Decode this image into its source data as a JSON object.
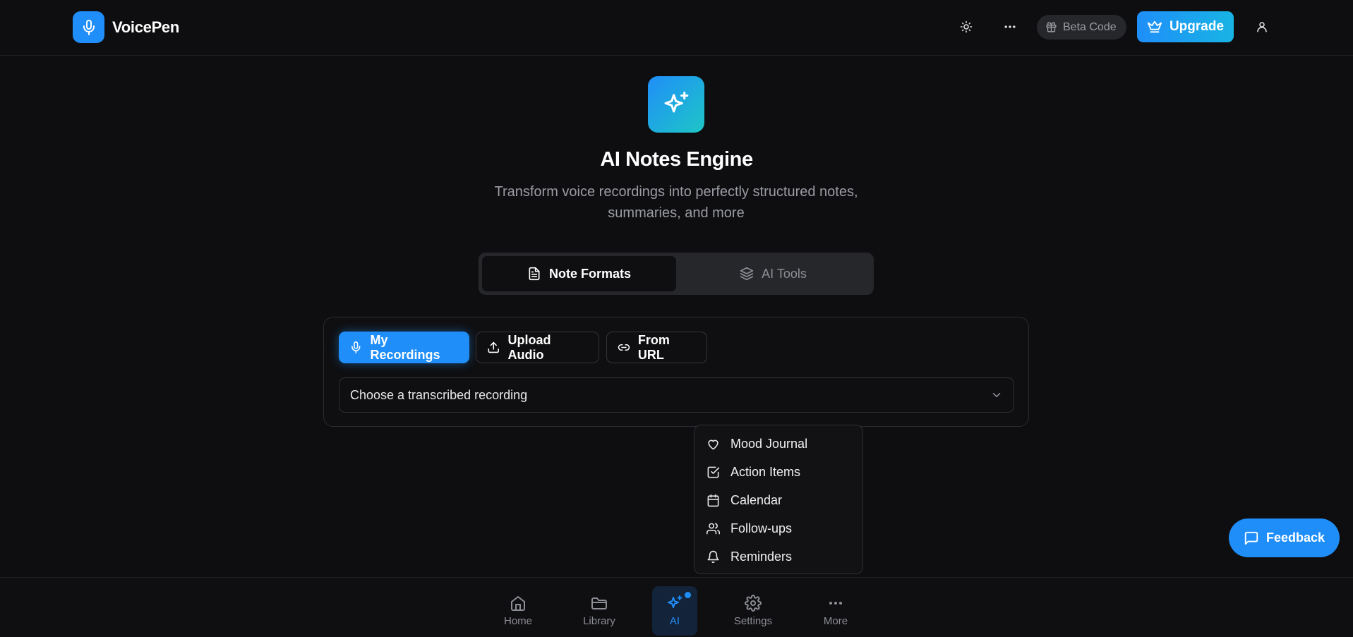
{
  "app": {
    "name": "VoicePen"
  },
  "header": {
    "beta_label": "Beta Code",
    "upgrade_label": "Upgrade"
  },
  "hero": {
    "title": "AI Notes Engine",
    "subtitle": "Transform voice recordings into perfectly structured notes, summaries, and more"
  },
  "tabs": [
    {
      "label": "Note Formats",
      "active": true
    },
    {
      "label": "AI Tools",
      "active": false
    }
  ],
  "sources": [
    {
      "label": "My Recordings",
      "active": true
    },
    {
      "label": "Upload Audio",
      "active": false
    },
    {
      "label": "From URL",
      "active": false
    }
  ],
  "recording_select": {
    "placeholder": "Choose a transcribed recording"
  },
  "menu": {
    "items": [
      {
        "label": "Mood Journal",
        "icon": "heart-icon"
      },
      {
        "label": "Action Items",
        "icon": "checkbox-icon"
      },
      {
        "label": "Calendar",
        "icon": "calendar-icon"
      },
      {
        "label": "Follow-ups",
        "icon": "users-icon"
      },
      {
        "label": "Reminders",
        "icon": "bell-icon"
      }
    ]
  },
  "feedback": {
    "label": "Feedback"
  },
  "bottom_nav": {
    "items": [
      {
        "label": "Home",
        "icon": "home-icon"
      },
      {
        "label": "Library",
        "icon": "folder-icon"
      },
      {
        "label": "AI",
        "icon": "sparkles-icon",
        "active": true
      },
      {
        "label": "Settings",
        "icon": "gear-icon"
      },
      {
        "label": "More",
        "icon": "more-icon"
      }
    ]
  },
  "colors": {
    "accent": "#1f8ef9",
    "background": "#0e0e10",
    "accent_gradient_end": "#1ec6c6"
  }
}
